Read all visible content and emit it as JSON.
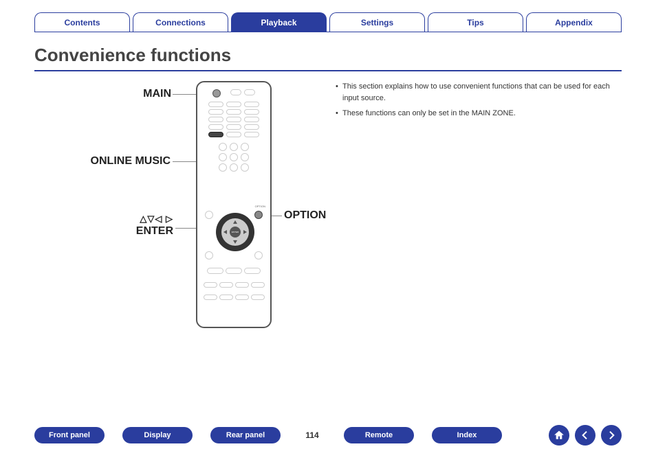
{
  "tabs": {
    "contents": "Contents",
    "connections": "Connections",
    "playback": "Playback",
    "settings": "Settings",
    "tips": "Tips",
    "appendix": "Appendix"
  },
  "title": "Convenience functions",
  "callouts": {
    "main": "MAIN",
    "online_music": "ONLINE MUSIC",
    "option": "OPTION",
    "enter": "ENTER",
    "arrows": "△▽◁ ▷"
  },
  "remote": {
    "option_label": "OPTION",
    "enter_label": "ENTER"
  },
  "notes": {
    "line1": "This section explains how to use convenient functions that can be used for each input source.",
    "line2": "These functions can only be set in the MAIN ZONE."
  },
  "bottom": {
    "front_panel": "Front panel",
    "display": "Display",
    "rear_panel": "Rear panel",
    "remote": "Remote",
    "index": "Index",
    "page": "114"
  }
}
